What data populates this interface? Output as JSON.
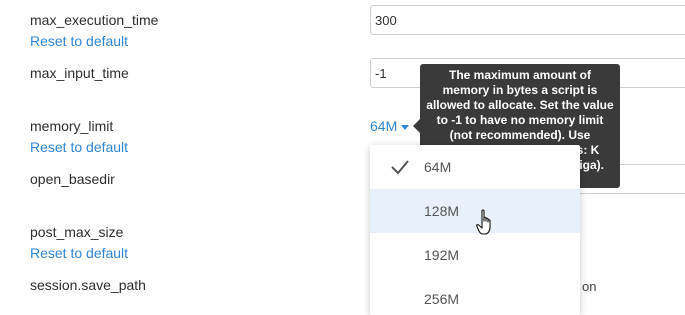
{
  "rows": [
    {
      "label": "max_execution_time",
      "value": "300",
      "reset": "Reset to default"
    },
    {
      "label": "max_input_time",
      "value": "-1"
    },
    {
      "label": "memory_limit",
      "value": "64M",
      "reset": "Reset to default"
    },
    {
      "label": "open_basedir",
      "value": ""
    },
    {
      "label": "post_max_size",
      "reset": "Reset to default"
    },
    {
      "label": "session.save_path",
      "value": "on"
    }
  ],
  "tooltip": {
    "text": "The maximum amount of memory in bytes a script is allowed to allocate. Set the value to -1 to have no memory limit (not recommended). Use shortcuts for byte values: K (kilo), M (mega), and G (giga). For example, 128M"
  },
  "dropdown": {
    "selected": "64M",
    "hovered": "128M",
    "options": [
      "64M",
      "128M",
      "192M",
      "256M"
    ]
  },
  "colors": {
    "link": "#2f87d8",
    "tooltip_bg": "#3a3a3a",
    "hover_bg": "#e8f1fb"
  },
  "icons": {
    "selected": "checkmark-icon",
    "cursor": "hand-pointer-icon",
    "dropdown": "caret-down-icon"
  }
}
